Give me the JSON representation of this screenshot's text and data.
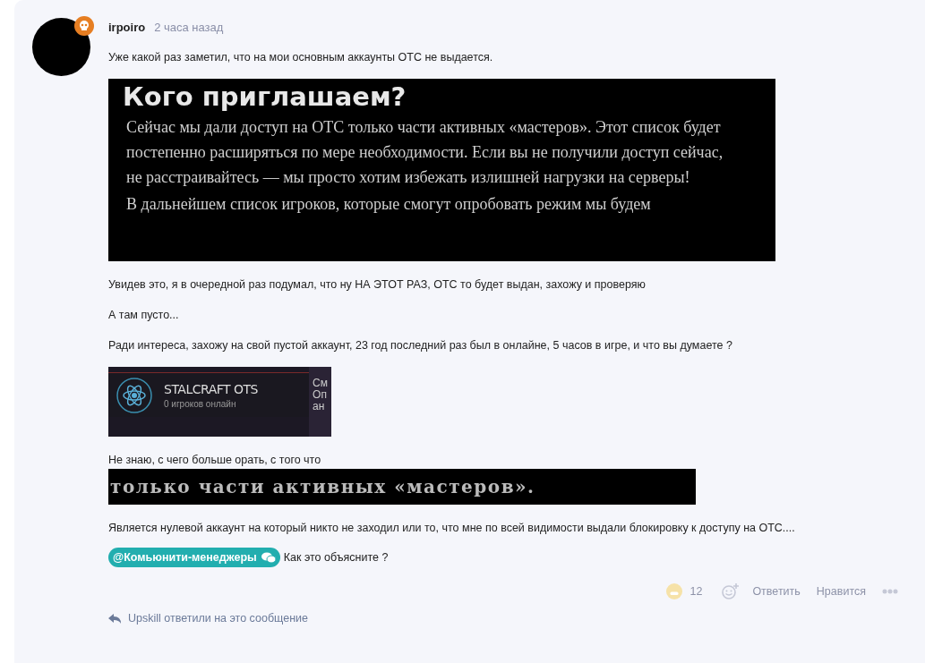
{
  "post": {
    "author": "irpoiro",
    "time": "2 часа назад",
    "paragraphs": [
      {
        "kind": "text",
        "text": "Уже какой раз заметил, что на мои основным аккаунты ОТС не выдается."
      },
      {
        "kind": "quote_image",
        "heading": "Кого приглашаем?",
        "lines": [
          "Сейчас мы дали доступ на ОТС только части активных «мастеров». Этот список будет постепенно расширяться по мере необходимости. Если вы не получили доступ сейчас, не расстраивайтесь — мы просто хотим избежать излишней нагрузки на серверы!",
          "В дальнейшем список игроков, которые смогут опробовать режим мы будем"
        ]
      },
      {
        "kind": "text",
        "text": "Увидев это, я в очередной раз подумал, что ну НА ЭТОТ РАЗ, ОТС то будет выдан, захожу и проверяю"
      },
      {
        "kind": "text",
        "text": "А там пусто..."
      },
      {
        "kind": "text",
        "text": "Ради интереса, захожу на свой пустой аккаунт, 23 год последний раз был в онлайне, 5 часов в игре, и что вы думаете ?"
      },
      {
        "kind": "server_image",
        "name": "STALCRAFT OTS",
        "online": "0 игроков онлайн",
        "side_text": [
          "См",
          "Оп",
          "ан"
        ]
      },
      {
        "kind": "text",
        "text": "Не знаю, с чего больше орать, с того что"
      },
      {
        "kind": "banner_image",
        "text": "только части активных «мастеров»."
      },
      {
        "kind": "text",
        "text": "Является нулевой аккаунт на который никто не заходил или то, что мне по всей видимости выдали блокировку к доступу на ОТС...."
      },
      {
        "kind": "mention",
        "mention": "@Комьюнити-менеджеры",
        "text": "Как это объясните ?"
      }
    ],
    "reaction_count": "12",
    "actions": [
      "Ответить",
      "Нравится"
    ],
    "replies_note": "Upskill ответили на это сообщение"
  }
}
